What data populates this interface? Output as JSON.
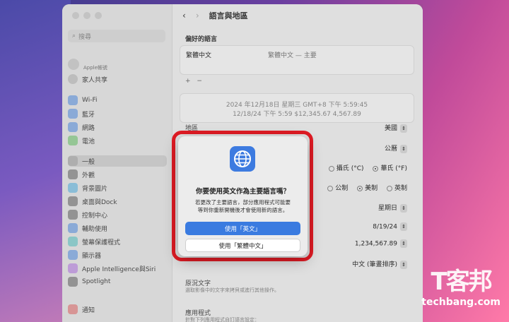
{
  "window": {
    "title": "語言與地區",
    "sidebar": {
      "search_placeholder": "搜尋",
      "account": "Apple帳號",
      "family": "家人共享",
      "items": [
        "Wi-Fi",
        "藍牙",
        "網路",
        "電池",
        "一般",
        "外觀",
        "背景圖片",
        "桌面與Dock",
        "控制中心",
        "輔助使用",
        "螢幕保護程式",
        "顯示器",
        "Apple Intelligence與Siri",
        "Spotlight",
        "通知"
      ],
      "selected": "一般"
    },
    "main": {
      "preferred_languages_header": "偏好的語言",
      "language_name": "繁體中文",
      "language_detail": "繁體中文 — 主要",
      "add_remove": [
        "+",
        "−"
      ],
      "preview_line1": "2024 年12月18日 星期三 GMT+8 下午 5:59:45",
      "preview_line2": "12/18/24 下午 5:59    $12,345.67    4,567.89",
      "region_label": "地區",
      "region_value": "美國",
      "calendar_value": "公曆",
      "temp_options": [
        "攝氏 (°C)",
        "華氏 (°F)"
      ],
      "measure_options": [
        "公制",
        "美制",
        "英制"
      ],
      "first_day": "星期日",
      "date_format": "8/19/24",
      "number_format": "1,234,567.89",
      "sort_order": "中文 (筆畫排序)",
      "live_text_title": "原況文字",
      "live_text_desc": "選取影像中的文字來拷貝或進行其他操作。",
      "apps_title": "應用程式",
      "apps_desc": "針對下列應用程式自訂語言設定："
    }
  },
  "dialog": {
    "title": "你要使用英文作為主要語言嗎？",
    "message_line1": "若更改了主要語言，部分應用程式可能要",
    "message_line2": "等到你重新開機後才會使用新的語言。",
    "primary_button": "使用「英文」",
    "secondary_button": "使用「繁體中文」"
  },
  "watermark": {
    "logo": "T客邦",
    "url": "techbang.com"
  },
  "colors": {
    "accent": "#3a7be0",
    "highlight_box": "#e01b24"
  }
}
